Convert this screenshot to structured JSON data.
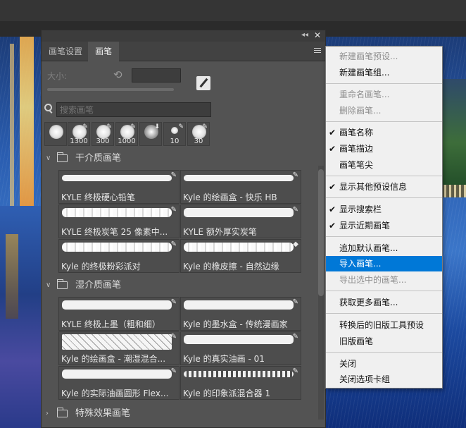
{
  "panel": {
    "tabs": [
      "画笔设置",
      "画笔"
    ],
    "size_label": "大小:",
    "search_placeholder": "搜索画笔",
    "recent_brushes": [
      "",
      "1300",
      "300",
      "1000",
      "",
      "10",
      "30"
    ]
  },
  "groups": [
    {
      "label": "干介质画笔",
      "brushes": [
        "KYLE 终极硬心铅笔",
        "Kyle 的绘画盒 - 快乐 HB",
        "KYLE 终极炭笔 25 像素中...",
        "KYLE 额外厚实炭笔",
        "Kyle 的终极粉彩派对",
        "Kyle 的橡皮擦 - 自然边缘"
      ]
    },
    {
      "label": "湿介质画笔",
      "brushes": [
        "KYLE 终极上墨（粗和细）",
        "Kyle 的墨水盒 - 传统漫画家",
        "Kyle 的绘画盒 - 潮湿混合...",
        "Kyle 的真实油画 - 01",
        "Kyle 的实际油画圆形 Flex...",
        "Kyle 的印象派混合器 1"
      ]
    },
    {
      "label": "特殊效果画笔",
      "brushes": []
    }
  ],
  "menu": {
    "items": [
      {
        "label": "新建画笔预设...",
        "disabled": true,
        "checked": false
      },
      {
        "label": "新建画笔组...",
        "disabled": false,
        "checked": false
      },
      {
        "label": "重命名画笔...",
        "disabled": true,
        "checked": false
      },
      {
        "label": "删除画笔...",
        "disabled": true,
        "checked": false
      },
      {
        "label": "画笔名称",
        "disabled": false,
        "checked": true
      },
      {
        "label": "画笔描边",
        "disabled": false,
        "checked": true
      },
      {
        "label": "画笔笔尖",
        "disabled": false,
        "checked": false
      },
      {
        "label": "显示其他预设信息",
        "disabled": false,
        "checked": true
      },
      {
        "label": "显示搜索栏",
        "disabled": false,
        "checked": true
      },
      {
        "label": "显示近期画笔",
        "disabled": false,
        "checked": true
      },
      {
        "label": "追加默认画笔...",
        "disabled": false,
        "checked": false
      },
      {
        "label": "导入画笔...",
        "disabled": false,
        "checked": false,
        "highlighted": true
      },
      {
        "label": "导出选中的画笔...",
        "disabled": true,
        "checked": false
      },
      {
        "label": "获取更多画笔...",
        "disabled": false,
        "checked": false
      },
      {
        "label": "转换后的旧版工具预设",
        "disabled": false,
        "checked": false
      },
      {
        "label": "旧版画笔",
        "disabled": false,
        "checked": false
      },
      {
        "label": "关闭",
        "disabled": false,
        "checked": false
      },
      {
        "label": "关闭选项卡组",
        "disabled": false,
        "checked": false
      }
    ]
  },
  "colors": {
    "highlight": "#0078d7",
    "panel_bg": "#535353",
    "menu_bg": "#f0f0f0"
  }
}
